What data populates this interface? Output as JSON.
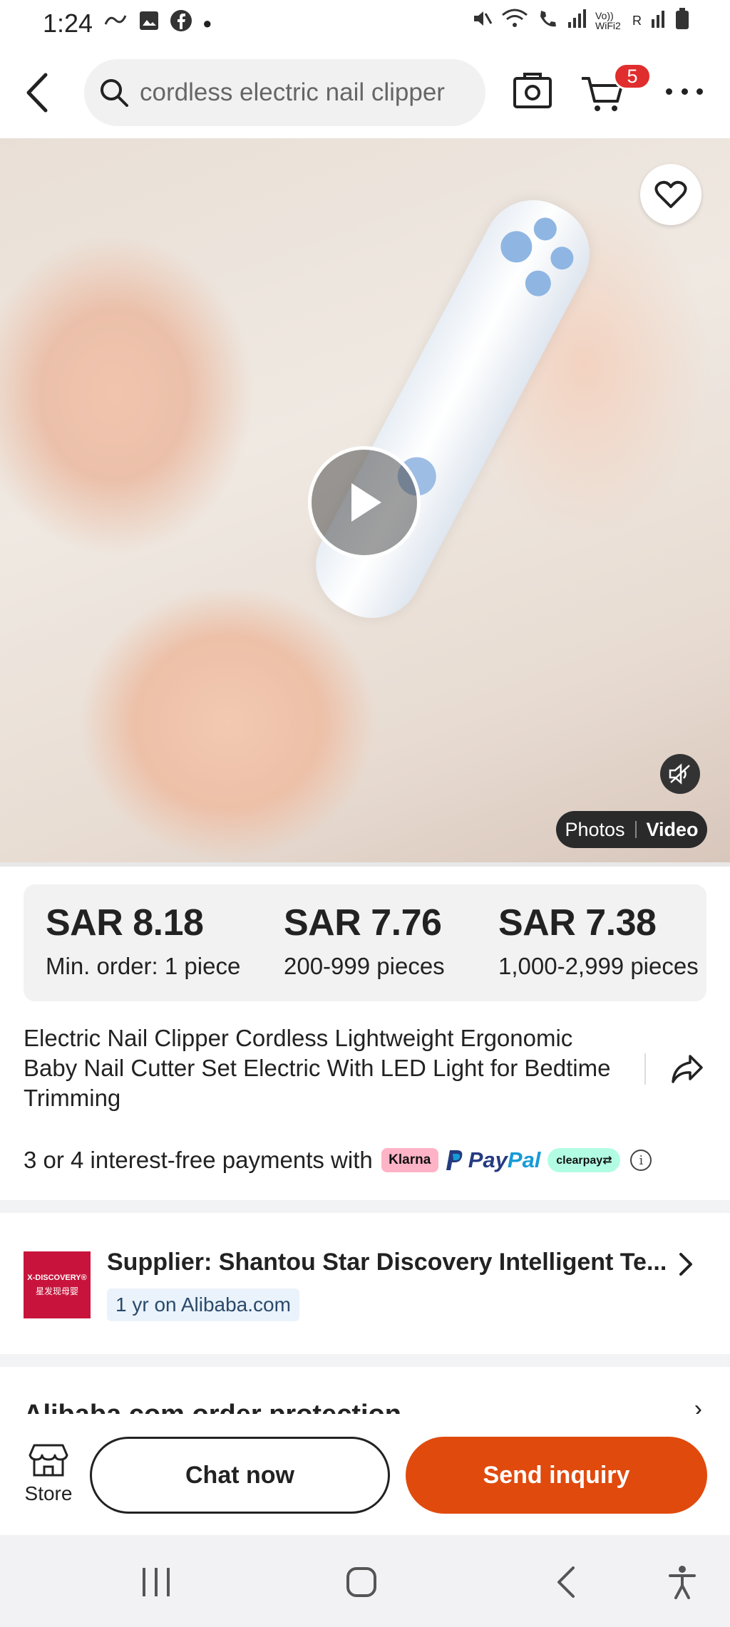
{
  "status_bar": {
    "time": "1:24",
    "right_text_1": "Vo)) WiFi2",
    "right_text_2": "R"
  },
  "header": {
    "search_value": "cordless electric nail clipper",
    "cart_count": "5"
  },
  "media": {
    "photos_label": "Photos",
    "video_label": "Video"
  },
  "pricing": {
    "tiers": [
      {
        "price": "SAR 8.18",
        "quantity": "Min. order: 1 piece"
      },
      {
        "price": "SAR 7.76",
        "quantity": "200-999 pieces"
      },
      {
        "price": "SAR 7.38",
        "quantity": "1,000-2,999 pieces"
      }
    ]
  },
  "product": {
    "title": "Electric Nail Clipper Cordless Lightweight Ergonomic Baby Nail Cutter Set Electric With LED Light for Bedtime Trimming"
  },
  "payments": {
    "text": "3 or 4 interest-free payments with",
    "klarna": "Klarna",
    "paypal_a": "Pay",
    "paypal_b": "Pal",
    "clearpay": "clearpay⇄",
    "info": "i"
  },
  "supplier": {
    "logo_line1": "X-DISCOVERY®",
    "logo_line2": "星发现母婴",
    "name": "Supplier: Shantou Star Discovery Intelligent Te...",
    "tenure": "1 yr on Alibaba.com"
  },
  "protection": {
    "title": "Alibaba.com order protection"
  },
  "actions": {
    "store_label": "Store",
    "chat_label": "Chat now",
    "inquiry_label": "Send inquiry"
  },
  "colors": {
    "accent": "#e04a0d",
    "badge": "#e02d2d",
    "supplier_logo": "#c8143c"
  }
}
